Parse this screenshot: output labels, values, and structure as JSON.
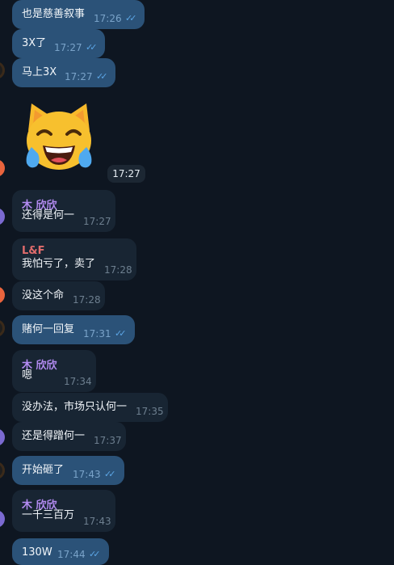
{
  "messages": [
    {
      "type": "out",
      "text": "也是慈善叙事",
      "time": "17:26"
    },
    {
      "type": "out",
      "text": "3X了",
      "time": "17:27"
    },
    {
      "type": "out",
      "text": "马上3X",
      "time": "17:27"
    },
    {
      "type": "sticker",
      "emoji": "😹",
      "time": "17:27"
    },
    {
      "type": "in",
      "name": "木 欣欣",
      "name_color": "#b38bf2",
      "text": "还得是何一",
      "time": "17:27"
    },
    {
      "type": "in",
      "name": "L&F",
      "name_color": "#e06c6c",
      "text": "我怕亏了，卖了",
      "time": "17:28"
    },
    {
      "type": "in",
      "text": "没这个命",
      "time": "17:28"
    },
    {
      "type": "out",
      "text": "赌何一回复",
      "time": "17:31"
    },
    {
      "type": "in",
      "name": "木 欣欣",
      "name_color": "#b38bf2",
      "text": "嗯",
      "time": "17:34"
    },
    {
      "type": "in",
      "text": "没办法，市场只认何一",
      "time": "17:35"
    },
    {
      "type": "in",
      "text": "还是得蹭何一",
      "time": "17:37"
    },
    {
      "type": "out",
      "text": "开始砸了",
      "time": "17:43"
    },
    {
      "type": "in",
      "name": "木 欣欣",
      "name_color": "#b38bf2",
      "text": "一千三百万",
      "time": "17:43"
    },
    {
      "type": "out",
      "text": "130W",
      "time": "17:44"
    }
  ],
  "icons": {
    "read_receipt": "double-check-icon"
  }
}
